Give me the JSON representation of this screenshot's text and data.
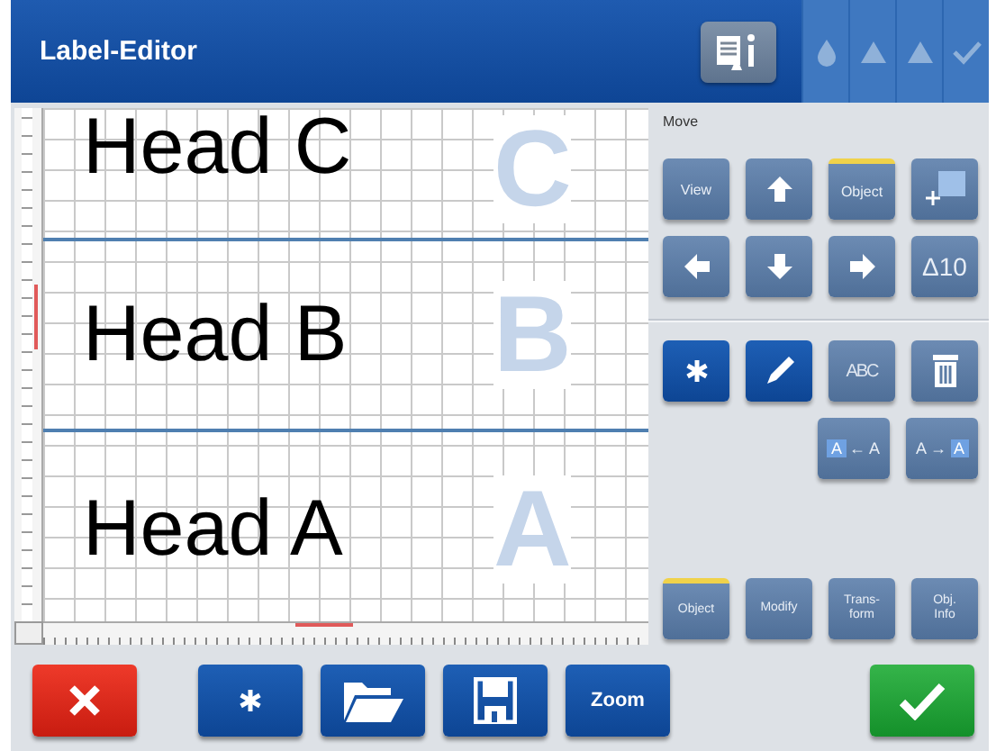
{
  "window": {
    "title": "Label-Editor"
  },
  "canvas": {
    "rows": [
      {
        "text": "Head C",
        "marker": "C"
      },
      {
        "text": "Head B",
        "marker": "B"
      },
      {
        "text": "Head A",
        "marker": "A"
      }
    ]
  },
  "move_panel": {
    "title": "Move",
    "buttons": [
      {
        "kind": "text",
        "label": "View",
        "selected": false
      },
      {
        "kind": "up",
        "selected": false
      },
      {
        "kind": "text",
        "label": "Object",
        "selected": true
      },
      {
        "kind": "frame",
        "selected": false
      },
      {
        "kind": "left",
        "selected": false
      },
      {
        "kind": "down",
        "selected": false
      },
      {
        "kind": "right",
        "selected": false
      },
      {
        "kind": "text",
        "label": "Δ10",
        "selected": false
      }
    ]
  },
  "tools": [
    {
      "kind": "new",
      "selected": true
    },
    {
      "kind": "pencil",
      "selected": true
    },
    {
      "kind": "abc",
      "label": "ABC",
      "selected": false
    },
    {
      "kind": "trash",
      "selected": false
    }
  ],
  "convert": [
    {
      "parts": [
        {
          "text": "A",
          "boxed": true
        },
        {
          "text": "←",
          "boxed": false
        },
        {
          "text": "A",
          "boxed": false
        }
      ]
    },
    {
      "parts": [
        {
          "text": "A",
          "boxed": false
        },
        {
          "text": "→",
          "boxed": false
        },
        {
          "text": "A",
          "boxed": true
        }
      ]
    }
  ],
  "modes": [
    {
      "label": "Object",
      "selected": true
    },
    {
      "label": "Modify",
      "selected": false
    },
    {
      "label": "Trans-\nform",
      "selected": false
    },
    {
      "label": "Obj.\nInfo",
      "selected": false
    }
  ],
  "bottom_bar": [
    {
      "kind": "cancel"
    },
    {
      "kind": "new"
    },
    {
      "kind": "open"
    },
    {
      "kind": "save"
    },
    {
      "kind": "text",
      "label": "Zoom"
    },
    {
      "kind": "confirm"
    }
  ]
}
